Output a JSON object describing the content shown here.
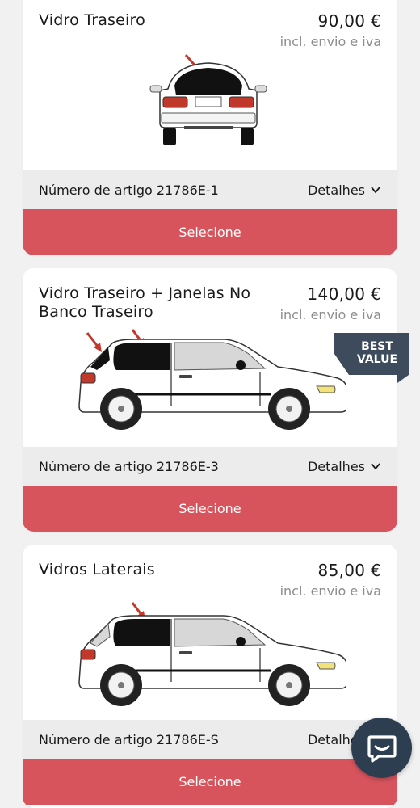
{
  "products": [
    {
      "title": "Vidro Traseiro",
      "price": "90,00 €",
      "price_note": "incl. envio e iva",
      "article": "Número de artigo 21786E-1",
      "details_label": "Detalhes",
      "select_label": "Selecione",
      "illustration": "car-rear-view"
    },
    {
      "title": "Vidro Traseiro + Janelas No Banco Traseiro",
      "price": "140,00 €",
      "price_note": "incl. envio e iva",
      "article": "Número de artigo 21786E-3",
      "details_label": "Detalhes",
      "select_label": "Selecione",
      "badge": "BEST VALUE",
      "illustration": "car-side-view-rear-windows"
    },
    {
      "title": "Vidros Laterais",
      "price": "85,00 €",
      "price_note": "incl. envio e iva",
      "article": "Número de artigo 21786E-S",
      "details_label": "Detalhes",
      "select_label": "Selecione",
      "illustration": "car-side-view-side-window"
    }
  ],
  "colors": {
    "select_button": "#d7545d",
    "badge": "#3e4b5c",
    "chat_button": "#2c3e50",
    "info_bar": "#ececec",
    "arrow": "#c0392b"
  },
  "icons": {
    "chat": "chat-bubble-icon",
    "details": "chevron-down-icon"
  }
}
